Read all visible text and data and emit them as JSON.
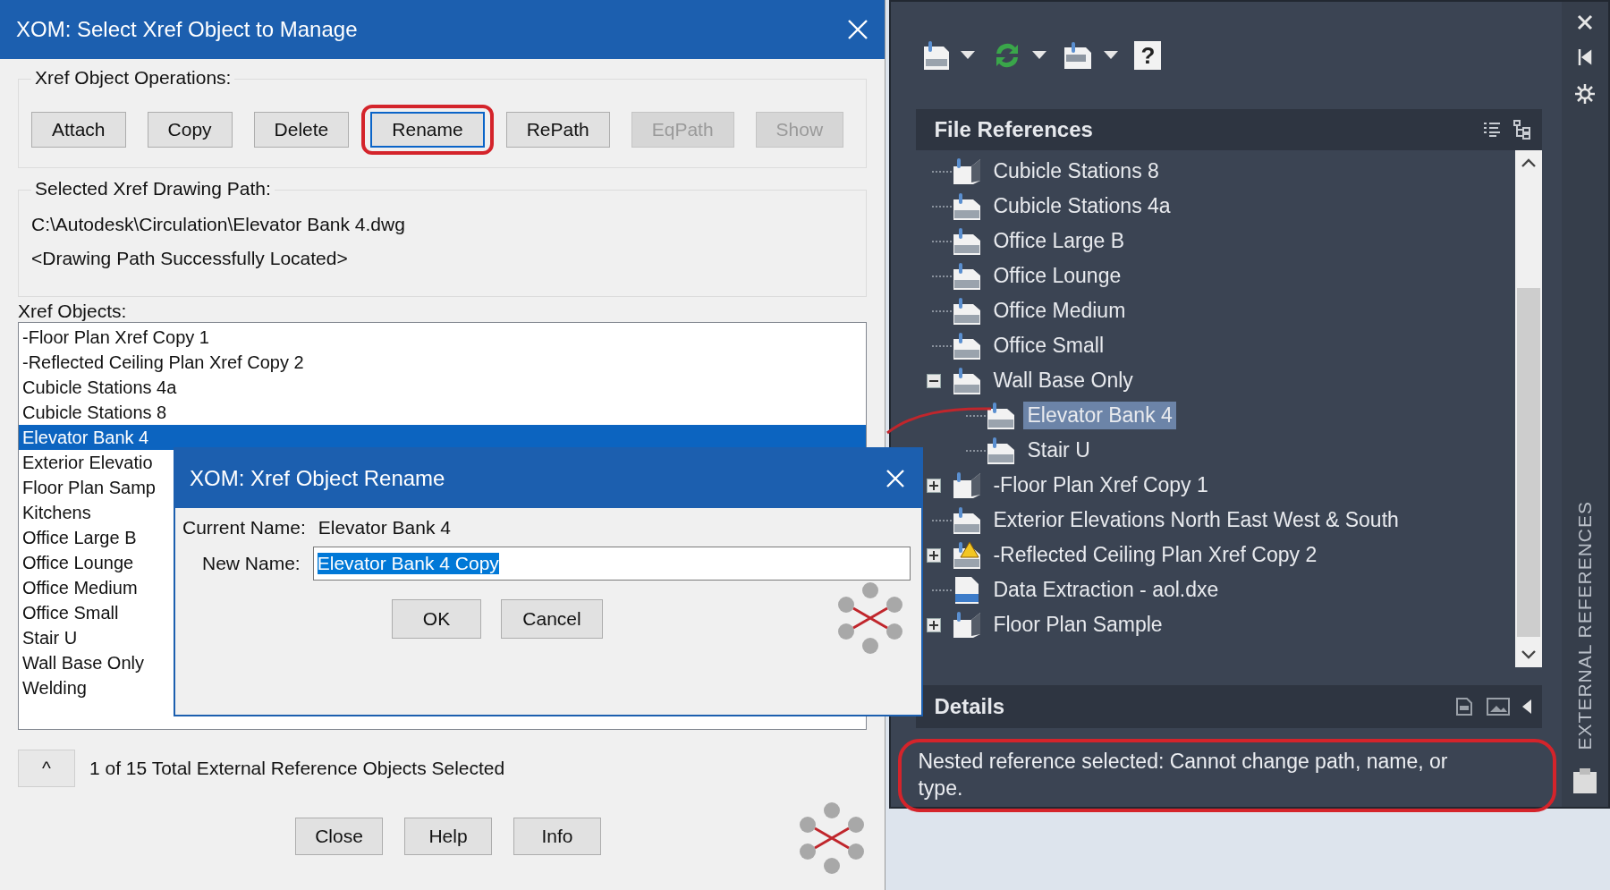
{
  "manage_dialog": {
    "title": "XOM: Select Xref Object to Manage",
    "operations": {
      "label": "Xref Object Operations:",
      "buttons": [
        {
          "label": "Attach",
          "disabled": false,
          "focused": false,
          "annotated": false
        },
        {
          "label": "Copy",
          "disabled": false,
          "focused": false,
          "annotated": false
        },
        {
          "label": "Delete",
          "disabled": false,
          "focused": false,
          "annotated": false
        },
        {
          "label": "Rename",
          "disabled": false,
          "focused": true,
          "annotated": true
        },
        {
          "label": "RePath",
          "disabled": false,
          "focused": false,
          "annotated": false
        },
        {
          "label": "EqPath",
          "disabled": true,
          "focused": false,
          "annotated": false
        },
        {
          "label": "Show",
          "disabled": true,
          "focused": false,
          "annotated": false
        }
      ]
    },
    "path_group": {
      "label": "Selected Xref Drawing Path:",
      "path": "C:\\Autodesk\\Circulation\\Elevator Bank 4.dwg",
      "status": "<Drawing Path Successfully Located>"
    },
    "objects": {
      "label": "Xref Objects:",
      "items": [
        {
          "name": "-Floor Plan Xref Copy 1",
          "selected": false
        },
        {
          "name": "-Reflected Ceiling Plan Xref Copy 2",
          "selected": false
        },
        {
          "name": "Cubicle Stations 4a",
          "selected": false
        },
        {
          "name": "Cubicle Stations 8",
          "selected": false
        },
        {
          "name": "Elevator Bank 4",
          "selected": true
        },
        {
          "name": "Exterior Elevatio",
          "selected": false
        },
        {
          "name": "Floor Plan Samp",
          "selected": false
        },
        {
          "name": "Kitchens",
          "selected": false
        },
        {
          "name": "Office Large B",
          "selected": false
        },
        {
          "name": "Office Lounge",
          "selected": false
        },
        {
          "name": "Office Medium",
          "selected": false
        },
        {
          "name": "Office Small",
          "selected": false
        },
        {
          "name": "Stair U",
          "selected": false
        },
        {
          "name": "Wall Base Only",
          "selected": false
        },
        {
          "name": "Welding",
          "selected": false
        }
      ]
    },
    "collapse_button": "^",
    "status": "1 of 15 Total External Reference Objects Selected",
    "footer_buttons": [
      "Close",
      "Help",
      "Info"
    ]
  },
  "rename_dialog": {
    "title": "XOM: Xref Object Rename",
    "current_name_label": "Current Name:",
    "current_name": "Elevator Bank 4",
    "new_name_label": "New Name:",
    "new_name": "Elevator Bank 4 Copy",
    "new_name_selected": true,
    "buttons": [
      "OK",
      "Cancel"
    ]
  },
  "xref_palette": {
    "toolbar": [
      {
        "kind": "attach",
        "dropdown": true
      },
      {
        "kind": "refresh",
        "dropdown": true
      },
      {
        "kind": "change-path",
        "dropdown": true
      },
      {
        "kind": "help",
        "glyph": "?"
      }
    ],
    "file_references": {
      "title": "File References",
      "items": [
        {
          "name": "Cubicle Stations 8",
          "kind": "overlay",
          "warning": false,
          "selected": false
        },
        {
          "name": "Cubicle Stations 4a",
          "kind": "dwg",
          "warning": false,
          "selected": false
        },
        {
          "name": "Office Large B",
          "kind": "dwg",
          "warning": false,
          "selected": false
        },
        {
          "name": "Office Lounge",
          "kind": "dwg",
          "warning": false,
          "selected": false
        },
        {
          "name": "Office Medium",
          "kind": "dwg",
          "warning": false,
          "selected": false
        },
        {
          "name": "Office Small",
          "kind": "dwg",
          "warning": false,
          "selected": false
        },
        {
          "name": "Wall Base Only",
          "kind": "dwg",
          "warning": false,
          "expanded": true,
          "selected": false,
          "children": [
            {
              "name": "Elevator Bank 4",
              "kind": "dwg",
              "warning": false,
              "selected": true
            },
            {
              "name": "Stair U",
              "kind": "dwg",
              "warning": false,
              "selected": false
            }
          ]
        },
        {
          "name": "-Floor Plan Xref Copy 1",
          "kind": "overlay",
          "warning": false,
          "expanded": false,
          "selected": false
        },
        {
          "name": "Exterior Elevations North East West & South",
          "kind": "dwg",
          "warning": false,
          "selected": false
        },
        {
          "name": "-Reflected Ceiling Plan Xref Copy 2",
          "kind": "dwg",
          "warning": true,
          "expanded": false,
          "selected": false
        },
        {
          "name": "Data Extraction - aol.dxe",
          "kind": "dxe",
          "warning": false,
          "selected": false
        },
        {
          "name": "Floor Plan Sample",
          "kind": "overlay",
          "warning": false,
          "expanded": false,
          "selected": false
        }
      ]
    },
    "details": {
      "title": "Details",
      "message": "Nested reference selected: Cannot change path, name, or type.",
      "annotated": true
    },
    "side_title": "EXTERNAL REFERENCES"
  }
}
